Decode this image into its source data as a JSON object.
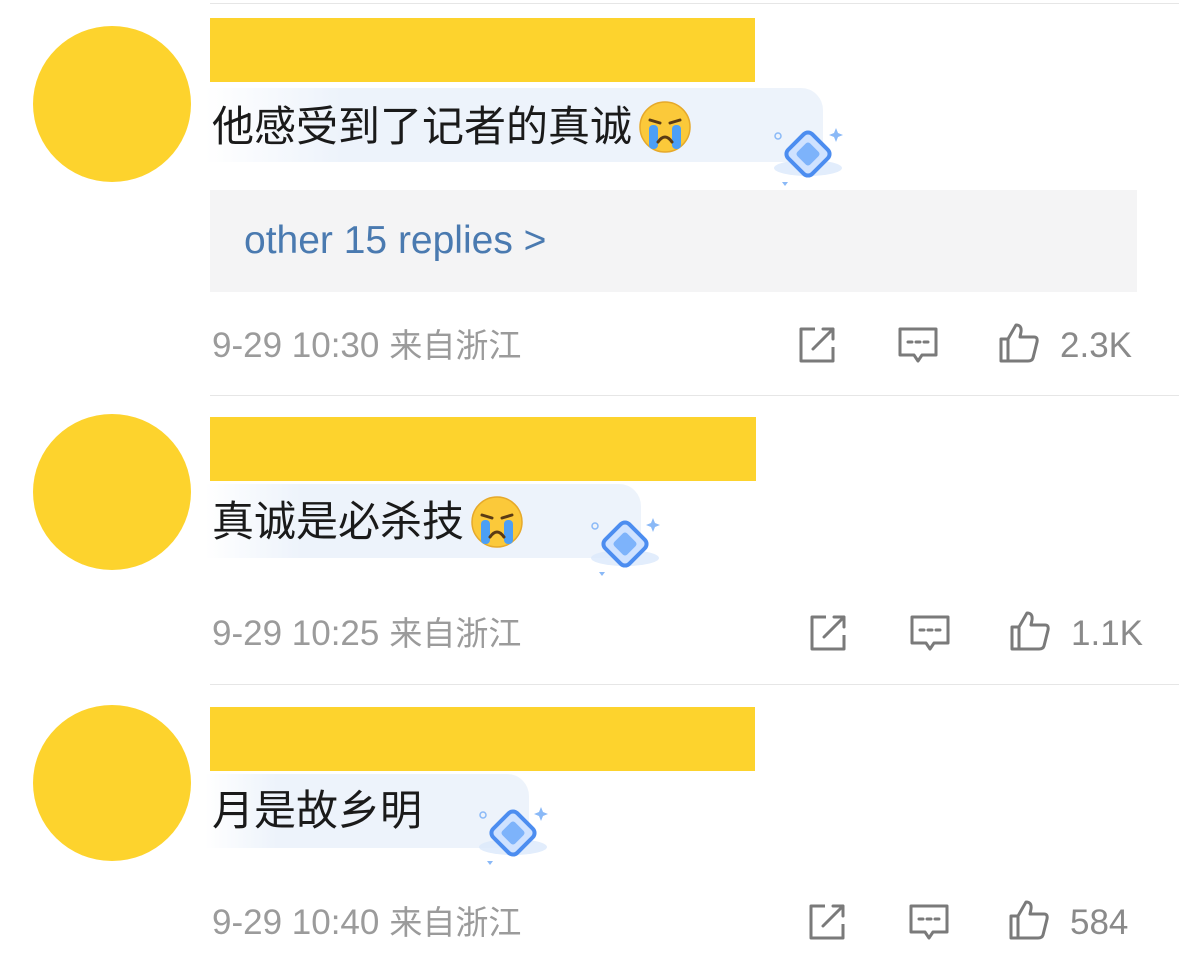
{
  "colors": {
    "avatar": "#fdd32d",
    "name_bar": "#fdd32d",
    "link": "#4a7ab0",
    "meta_text": "#9b9b9b",
    "bubble": "#edf3fb",
    "replies_bg": "#f4f4f5"
  },
  "comments": [
    {
      "text": "他感受到了记者的真诚",
      "emoji": "loudly-crying-face-icon",
      "badge": "diamond-badge-icon",
      "replies_link": "other 15 replies >",
      "time": "9-29 10:30",
      "location": "来自浙江",
      "likes": "2.3K"
    },
    {
      "text": "真诚是必杀技",
      "emoji": "loudly-crying-face-icon",
      "badge": "diamond-badge-icon",
      "time": "9-29 10:25",
      "location": "来自浙江",
      "likes": "1.1K"
    },
    {
      "text": "月是故乡明",
      "badge": "diamond-badge-icon",
      "time": "9-29 10:40",
      "location": "来自浙江",
      "likes": "584"
    }
  ],
  "icons": {
    "share": "share-icon",
    "reply": "comment-icon",
    "like": "thumbs-up-icon"
  }
}
